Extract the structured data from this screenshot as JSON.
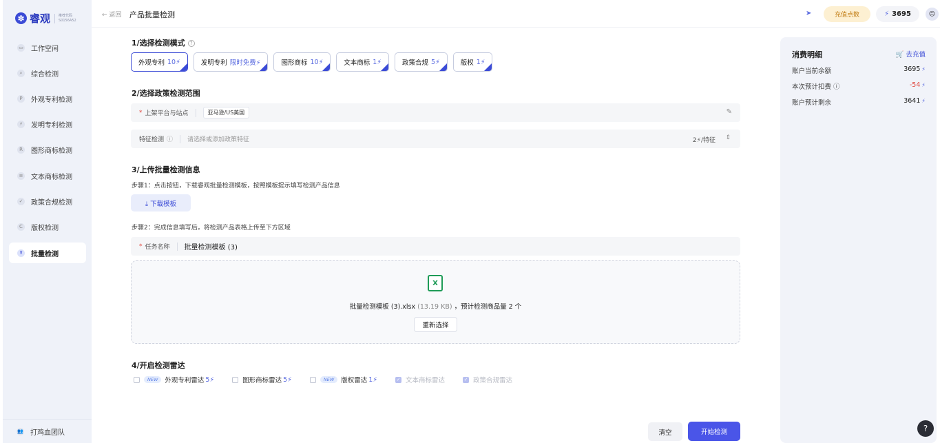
{
  "brand": {
    "logo": "✽",
    "name": "睿观",
    "sub_line1": "推荐代码",
    "sub_line2": "S0156A52"
  },
  "sidebar": {
    "items": [
      {
        "icon": "workspace-icon",
        "glyph": "▭",
        "label": "工作空间"
      },
      {
        "icon": "search-icon",
        "glyph": "⌕",
        "label": "综合检测"
      },
      {
        "icon": "design-patent-icon",
        "glyph": "P",
        "label": "外观专利检测"
      },
      {
        "icon": "invention-icon",
        "glyph": "⚡",
        "label": "发明专利检测"
      },
      {
        "icon": "image-trademark-icon",
        "glyph": "R",
        "label": "图形商标检测"
      },
      {
        "icon": "text-trademark-icon",
        "glyph": "≡",
        "label": "文本商标检测"
      },
      {
        "icon": "policy-icon",
        "glyph": "✓",
        "label": "政策合规检测"
      },
      {
        "icon": "copyright-icon",
        "glyph": "C",
        "label": "版权检测"
      },
      {
        "icon": "batch-upload-icon",
        "glyph": "⇪",
        "label": "批量检测",
        "active": true
      }
    ],
    "footer": {
      "icon": "team-icon",
      "glyph": "👥",
      "label": "打鸡血团队"
    }
  },
  "topbar": {
    "back": "← 返回",
    "title": "产品批量检测",
    "recharge": "充值点数",
    "points": "3695",
    "bolt": "⚡",
    "avatar": "☺"
  },
  "section1": {
    "title": "1/选择检测模式",
    "help": "?",
    "modes": [
      {
        "label": "外观专利",
        "cost": "10⚡",
        "selected": true
      },
      {
        "label": "发明专利",
        "cost": "限时免费⚡",
        "selected": false
      },
      {
        "label": "图形商标",
        "cost": "10⚡",
        "selected": false
      },
      {
        "label": "文本商标",
        "cost": "1⚡",
        "selected": false
      },
      {
        "label": "政策合规",
        "cost": "5⚡",
        "selected": false
      },
      {
        "label": "版权",
        "cost": "1⚡",
        "selected": false
      }
    ]
  },
  "section2": {
    "title": "2/选择政策检测范围",
    "platform_label": "上架平台与站点",
    "required_mark": "*",
    "platform_value": "亚马逊/US美国",
    "edit_glyph": "✎",
    "feature_label": "特征检测",
    "feature_help": "ⓘ",
    "feature_placeholder": "请选择或添加政策特征",
    "feature_cost": "2⚡/特征",
    "updown_glyph": "⇕"
  },
  "section3": {
    "title": "3/上传批量检测信息",
    "step1": "步骤1：点击按钮，下载睿观批量检测模板，按照模板提示填写检测产品信息",
    "download_button": "⤓ 下载模板",
    "step2": "步骤2：完成信息填写后，将检测产品表格上传至下方区域",
    "task_label": "任务名称",
    "task_value": "批量检测模板 (3)",
    "file_icon": "X",
    "file_name": "批量检测模板 (3).xlsx",
    "file_size": "(13.19 KB)",
    "file_count": "，预计检测商品量 2 个",
    "reselect": "重新选择"
  },
  "section4": {
    "title": "4/开启检测雷达",
    "radars": [
      {
        "label": "外观专利雷达",
        "cost": "5⚡",
        "new": true,
        "checked": false,
        "disabled": false
      },
      {
        "label": "图形商标雷达",
        "cost": "5⚡",
        "new": false,
        "checked": false,
        "disabled": false
      },
      {
        "label": "版权雷达",
        "cost": "1⚡",
        "new": true,
        "checked": false,
        "disabled": false
      },
      {
        "label": "文本商标雷达",
        "cost": "",
        "new": false,
        "checked": true,
        "disabled": true
      },
      {
        "label": "政策合规雷达",
        "cost": "",
        "new": false,
        "checked": true,
        "disabled": true
      }
    ],
    "new_badge": "NEW"
  },
  "actions": {
    "clear": "清空",
    "start": "开始检测"
  },
  "cost_panel": {
    "title": "消费明细",
    "recharge": "🛒 去充值",
    "rows": [
      {
        "label": "账户当前余额",
        "value": "3695",
        "negative": false
      },
      {
        "label": "本次预计扣费 ⓘ",
        "value": "-54",
        "negative": true
      },
      {
        "label": "账户预计剩余",
        "value": "3641",
        "negative": false
      }
    ]
  },
  "help_button": "?",
  "colors": {
    "accent": "#3b4bd6",
    "primary_button": "#4a55e8",
    "danger": "#e0463d",
    "recharge_bg": "#fdf0d2"
  }
}
